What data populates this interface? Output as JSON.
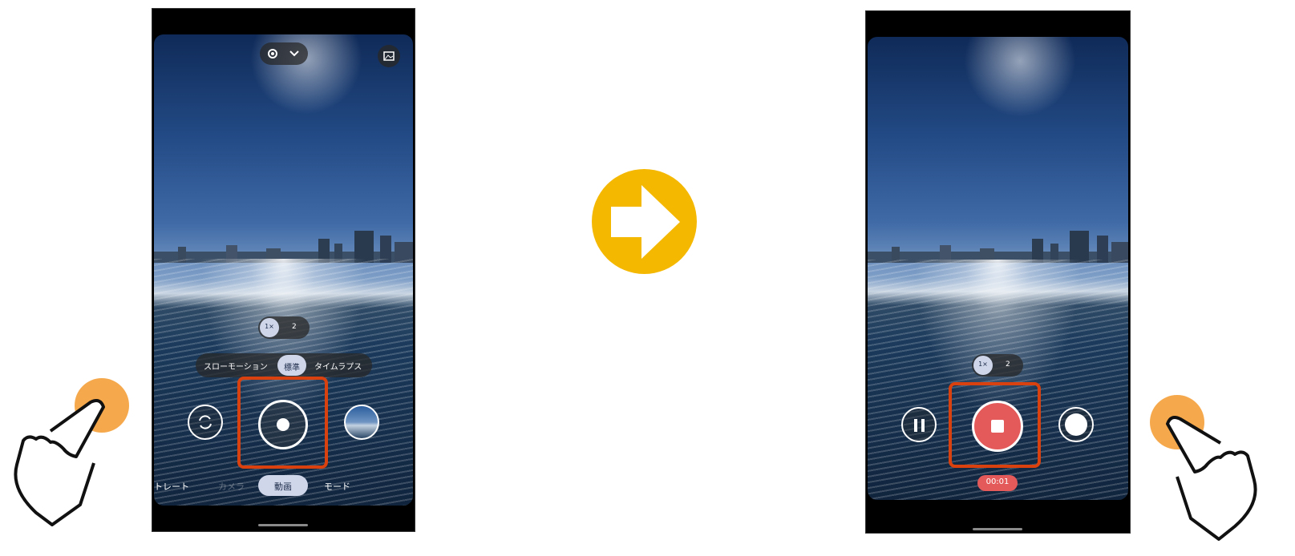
{
  "before": {
    "zoom": {
      "option1": "1×",
      "option2": "2"
    },
    "speed_modes": {
      "slow": "スローモーション",
      "normal": "標準",
      "timelapse": "タイムラプス"
    },
    "camera_modes": {
      "portrait": "トレート",
      "camera": "カメラ",
      "video": "動画",
      "more": "モード"
    }
  },
  "after": {
    "zoom": {
      "option1": "1×",
      "option2": "2"
    },
    "timer": "00:01"
  },
  "colors": {
    "highlight": "#d9410e",
    "arrow": "#f5b800",
    "finger_tip": "#f5a94c",
    "record": "#e45a5a"
  }
}
